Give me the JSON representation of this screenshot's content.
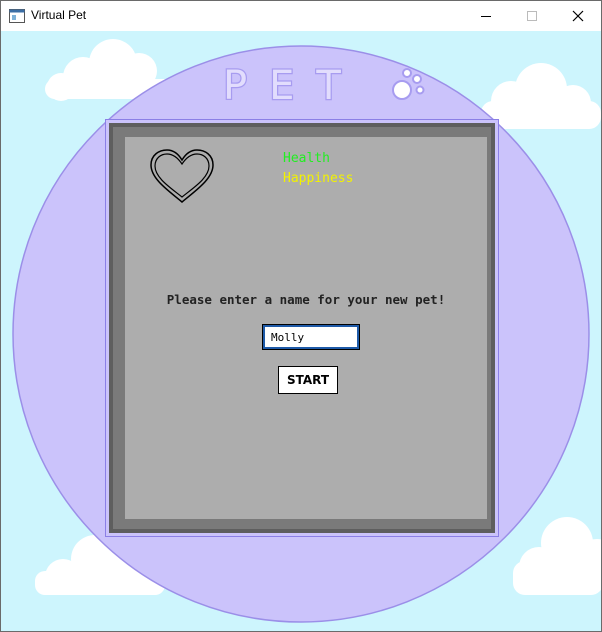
{
  "window": {
    "title": "Virtual Pet",
    "icon": "app-window-icon",
    "controls": [
      "minimize-icon",
      "maximize-icon",
      "close-icon"
    ]
  },
  "logo": {
    "text": "PET",
    "icon": "paw-icon"
  },
  "stats": {
    "health_label": "Health",
    "happiness_label": "Happiness",
    "health_color": "#22ee22",
    "happiness_color": "#f2f200"
  },
  "heart": {
    "icon": "heart-icon"
  },
  "form": {
    "prompt": "Please enter a name for your new pet!",
    "name_value": "Molly",
    "start_label": "START"
  },
  "colors": {
    "sky": "#cdf5fd",
    "circle": "#cbc3fb",
    "panel": "#adadad",
    "frame": "#5e5e5e"
  }
}
